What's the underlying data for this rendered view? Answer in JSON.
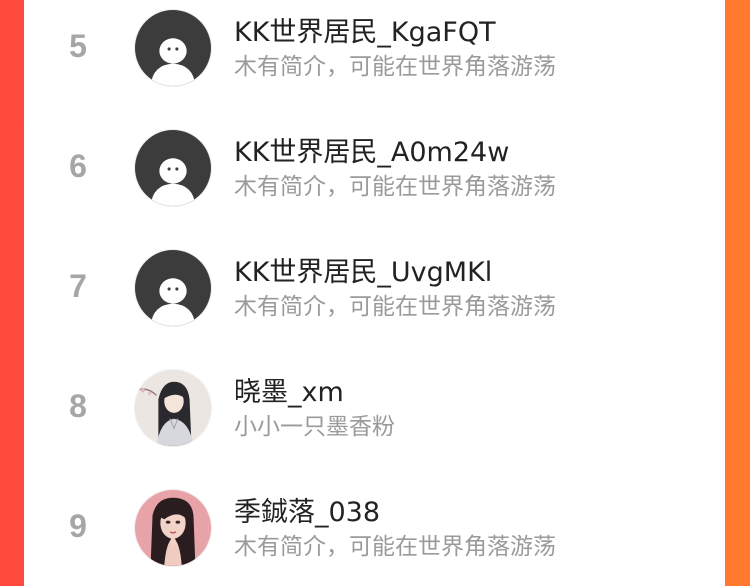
{
  "ranking": {
    "items": [
      {
        "rank": "5",
        "name": "KK世界居民_KgaFQT",
        "bio": "木有简介，可能在世界角落游荡",
        "avatar": "default-avatar-icon"
      },
      {
        "rank": "6",
        "name": "KK世界居民_A0m24w",
        "bio": "木有简介，可能在世界角落游荡",
        "avatar": "default-avatar-icon"
      },
      {
        "rank": "7",
        "name": "KK世界居民_UvgMKl",
        "bio": "木有简介，可能在世界角落游荡",
        "avatar": "default-avatar-icon"
      },
      {
        "rank": "8",
        "name": "晓墨_xm",
        "bio": "小小一只墨香粉",
        "avatar": "anime-character-avatar"
      },
      {
        "rank": "9",
        "name": "季鋮落_038",
        "bio": "木有简介，可能在世界角落游荡",
        "avatar": "portrait-avatar"
      }
    ]
  },
  "colors": {
    "background_left": "#ff4a3d",
    "background_right": "#ff7a2e",
    "rank_color": "#a6a6a6",
    "bio_color": "#9a9a9a"
  }
}
